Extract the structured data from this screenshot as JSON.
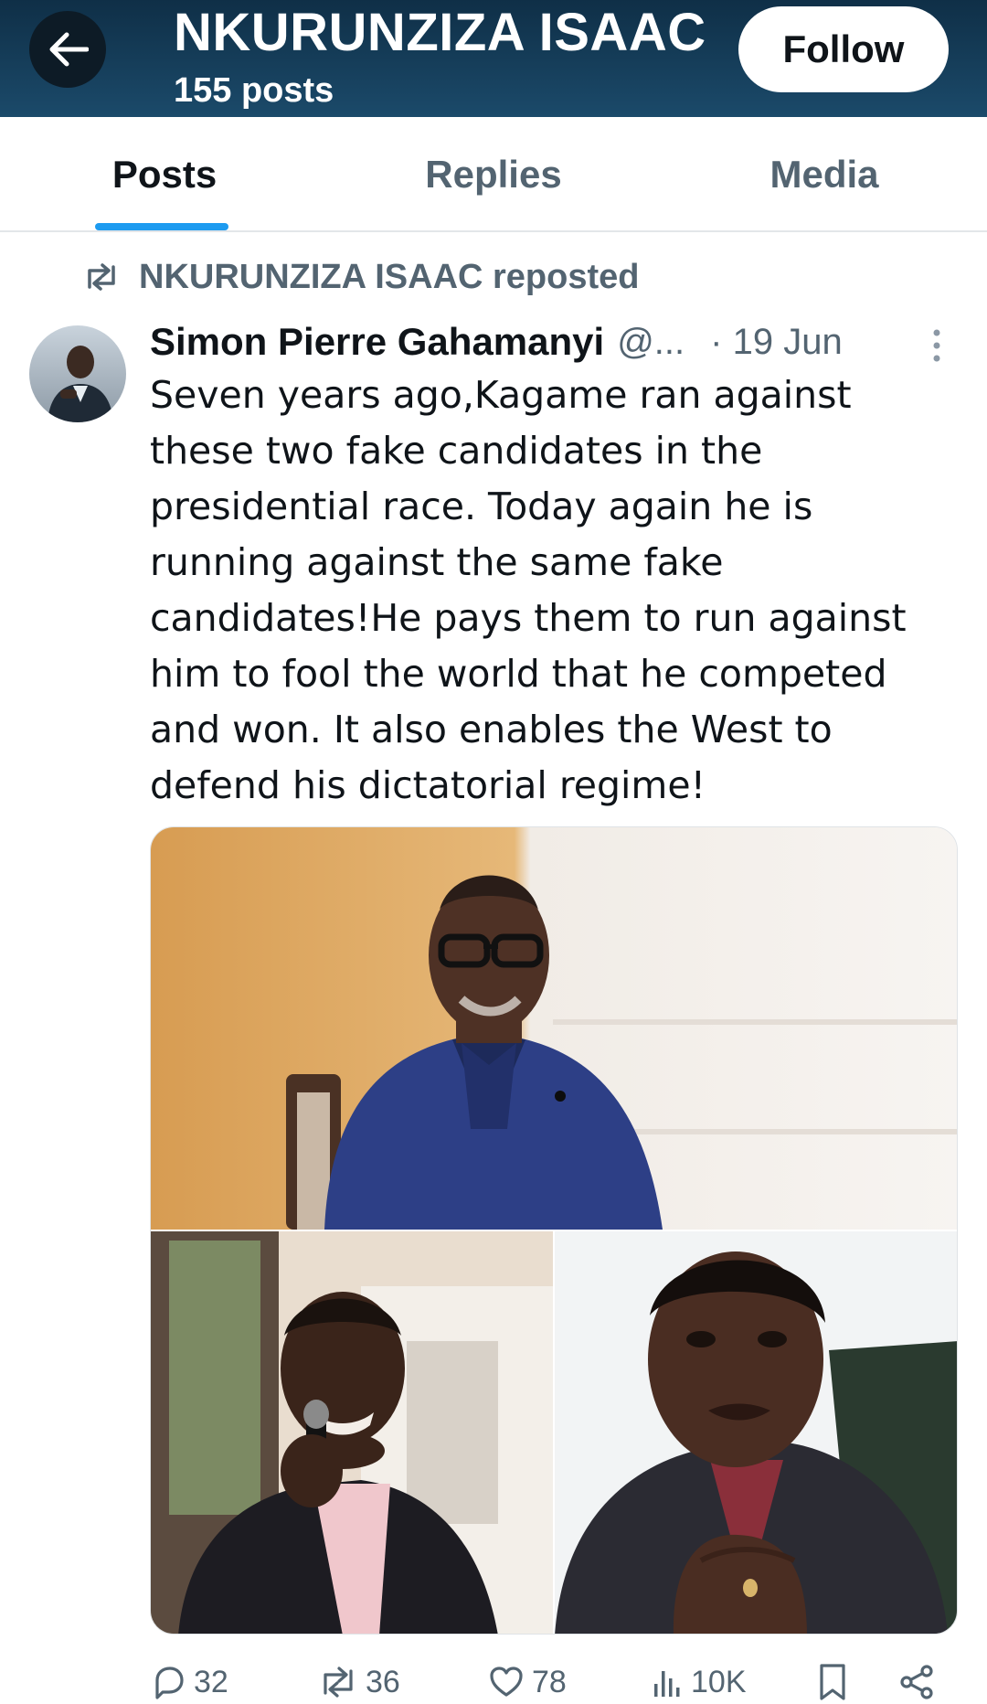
{
  "header": {
    "name": "NKURUNZIZA ISAAC",
    "post_count": "155 posts",
    "follow_label": "Follow",
    "back_icon": "arrow-left-icon"
  },
  "tabs": [
    {
      "label": "Posts",
      "active": true
    },
    {
      "label": "Replies",
      "active": false
    },
    {
      "label": "Media",
      "active": false
    }
  ],
  "repost": {
    "icon": "repost-icon",
    "label": "NKURUNZIZA ISAAC reposted"
  },
  "tweet": {
    "author_name": "Simon Pierre Gahamanyi",
    "author_handle": "@...",
    "date": "· 19 Jun",
    "text": "Seven years ago,Kagame ran against\nthese two fake candidates in the\npresidential race. Today again he is\nrunning against the same fake\ncandidates!He pays them to run against\nhim to fool the world that he competed\nand won. It also enables the West to\ndefend his dictatorial regime!",
    "media_count": 3
  },
  "actions": {
    "replies": "32",
    "reposts": "36",
    "likes": "78",
    "views": "10K"
  },
  "colors": {
    "header_bg": "#14405e",
    "accent": "#1d9bf0",
    "muted_text": "#536471"
  }
}
